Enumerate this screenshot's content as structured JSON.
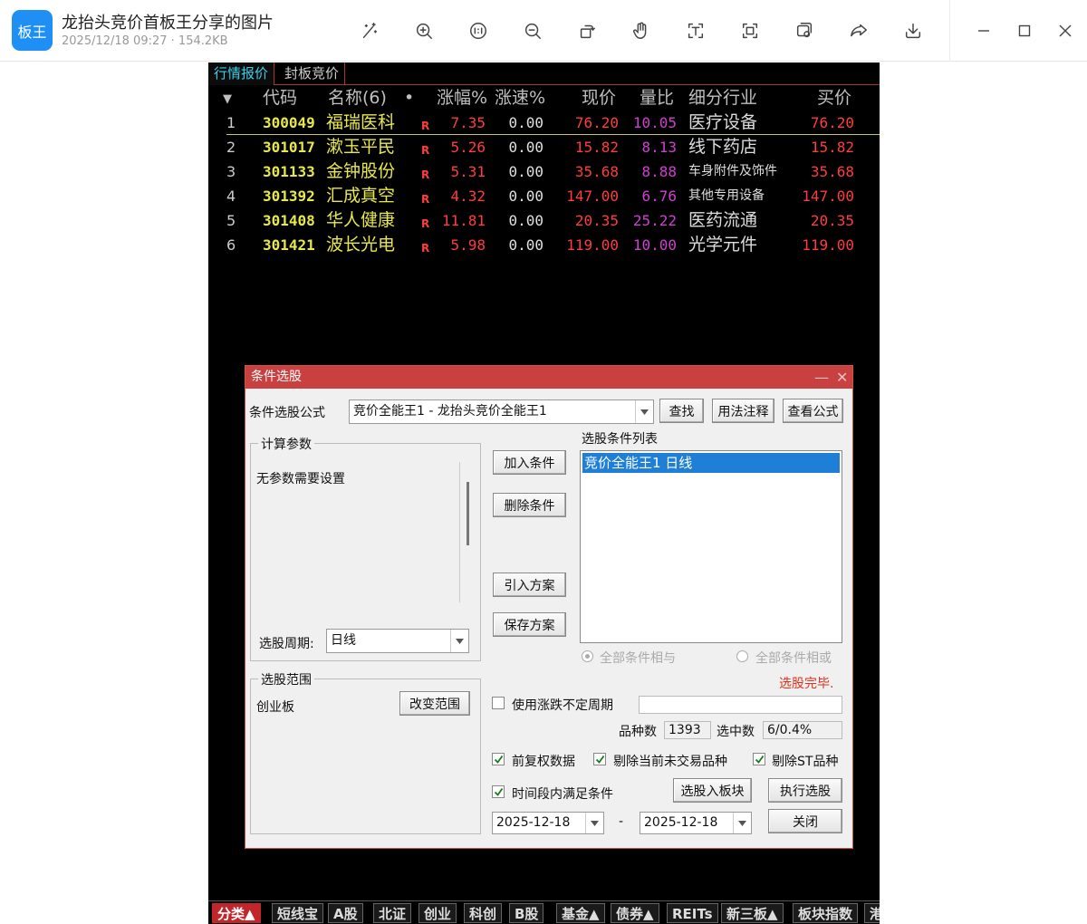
{
  "viewer": {
    "app_icon_label": "板王",
    "title": "龙抬头竞价首板王分享的图片",
    "subtitle": "2025/12/18 09:27 · 154.2KB",
    "tools": [
      "magic-wand-icon",
      "zoom-in-icon",
      "actual-size-icon",
      "zoom-out-icon",
      "rotate-icon",
      "hand-icon",
      "text-recognition-icon",
      "scan-icon",
      "copy-icon",
      "share-icon",
      "download-icon"
    ],
    "window_controls": [
      "minimize-icon",
      "maximize-icon",
      "close-icon"
    ]
  },
  "terminal": {
    "tabs": [
      "行情报价",
      "封板竞价"
    ],
    "columns": {
      "sort": "▼",
      "code": "代码",
      "name": "名称(6)",
      "dot": "•",
      "chg": "涨幅%",
      "speed": "涨速%",
      "price": "现价",
      "ratio": "量比",
      "industry": "细分行业",
      "bid": "买价"
    },
    "rows": [
      {
        "idx": "1",
        "code": "300049",
        "name": "福瑞医科",
        "flag": "R",
        "chg": "7.35",
        "speed": "0.00",
        "price": "76.20",
        "ratio": "10.05",
        "industry": "医疗设备",
        "bid": "76.20"
      },
      {
        "idx": "2",
        "code": "301017",
        "name": "漱玉平民",
        "flag": "R",
        "chg": "5.26",
        "speed": "0.00",
        "price": "15.82",
        "ratio": "8.13",
        "industry": "线下药店",
        "bid": "15.82"
      },
      {
        "idx": "3",
        "code": "301133",
        "name": "金钟股份",
        "flag": "R",
        "chg": "5.31",
        "speed": "0.00",
        "price": "35.68",
        "ratio": "8.88",
        "industry": "车身附件及饰件",
        "bid": "35.68"
      },
      {
        "idx": "4",
        "code": "301392",
        "name": "汇成真空",
        "flag": "R",
        "chg": "4.32",
        "speed": "0.00",
        "price": "147.00",
        "ratio": "6.76",
        "industry": "其他专用设备",
        "bid": "147.00"
      },
      {
        "idx": "5",
        "code": "301408",
        "name": "华人健康",
        "flag": "R",
        "chg": "11.81",
        "speed": "0.00",
        "price": "20.35",
        "ratio": "25.22",
        "industry": "医药流通",
        "bid": "20.35"
      },
      {
        "idx": "6",
        "code": "301421",
        "name": "波长光电",
        "flag": "R",
        "chg": "5.98",
        "speed": "0.00",
        "price": "119.00",
        "ratio": "10.00",
        "industry": "光学元件",
        "bid": "119.00"
      }
    ],
    "bottom_tabs": [
      "分类▲",
      "短线宝",
      "A股",
      "北证",
      "创业",
      "科创",
      "B股",
      "基金▲",
      "债券▲",
      "REITs",
      "新三板▲",
      "板块指数",
      "港"
    ]
  },
  "dialog": {
    "title": "条件选股",
    "minimize": "—",
    "close": "✕",
    "formula_label": "条件选股公式",
    "formula_value": "竞价全能王1  -  龙抬头竞价全能王1",
    "find_button": "查找",
    "usage_button": "用法注释",
    "view_button": "查看公式",
    "params_group": "计算参数",
    "params_text": "无参数需要设置",
    "period_label": "选股周期:",
    "period_value": "日线",
    "add_button": "加入条件",
    "delete_button": "删除条件",
    "import_button": "引入方案",
    "save_button": "保存方案",
    "list_label": "选股条件列表",
    "list_items": [
      "竞价全能王1  日线"
    ],
    "radio_and": "全部条件相与",
    "radio_or": "全部条件相或",
    "status": "选股完毕.",
    "range_group": "选股范围",
    "range_value": "创业板",
    "change_range_button": "改变范围",
    "use_period_label": "使用涨跌不定周期",
    "count_label": "品种数",
    "count_value": "1393",
    "selected_label": "选中数",
    "selected_value": "6/0.4%",
    "cb_fq": "前复权数据",
    "cb_untraded": "剔除当前未交易品种",
    "cb_st": "剔除ST品种",
    "cb_period": "时间段内满足条件",
    "to_block_button": "选股入板块",
    "execute_button": "执行选股",
    "date_from": "2025-12-18",
    "date_sep": "-",
    "date_to": "2025-12-18",
    "close_button": "关闭"
  },
  "colors": {
    "accent": "#1e90f5",
    "dialog_title": "#c94040",
    "price_up": "#ff3d3d",
    "code_yellow": "#e8e848",
    "ratio_magenta": "#d040d0",
    "selection": "#1f7fd6"
  }
}
